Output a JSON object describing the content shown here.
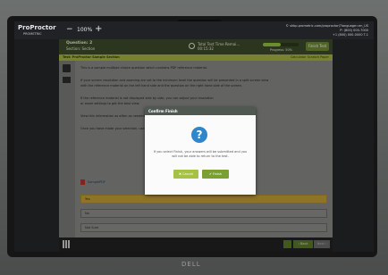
{
  "app": {
    "logo": "ProProctor",
    "logo_sub": "PROMETRIC",
    "zoom_minus": "−",
    "zoom_value": "100%",
    "zoom_plus": "+",
    "contact_lines": [
      "© shbp.prometric.com/proproctor/?language=en_US",
      "P: (800) 000-7000",
      "+1 (800) 000-0000 T-1"
    ]
  },
  "exam": {
    "question_number": "Question: 2",
    "section": "Section: Section",
    "timer_label": "Total Test Time Remai...",
    "timer_value": "00:15:32",
    "progress_percent": 50,
    "progress_text": "Progress: 50%",
    "finish_label": "Finish Test",
    "section_title": "Test: ProProctor Sample Section",
    "section_links": "Calculator   Scratch Paper"
  },
  "question": {
    "lines": [
      "This is a sample multiple choice question which contains PDF reference material.",
      "If your screen resolution and zooming are set to the minimum level the question will be presented in a split screen view",
      "with the reference material on the left hand side and the question on the right hand side of the screen.",
      "If the reference material is not displayed side by side, you can adjust your resolution",
      "or zoom settings to get the best view.",
      "View this information as often as needed.",
      "Once you have made your selection, use the Next button to go to the next question."
    ],
    "pdf_link": "SamplePDF",
    "options": [
      "Yes",
      "No",
      "Not Sure"
    ],
    "selected_index": 0
  },
  "nav": {
    "back_label": "‹ Back",
    "next_label": "Next ›"
  },
  "modal": {
    "title": "Confirm Finish",
    "icon": "?",
    "message": "If you select Finish, your answers will be submitted and you will not be able to return to the test.",
    "cancel_label": "✖ Cancel",
    "finish_label": "✔ Finish"
  },
  "laptop": {
    "brand": "DELL"
  }
}
